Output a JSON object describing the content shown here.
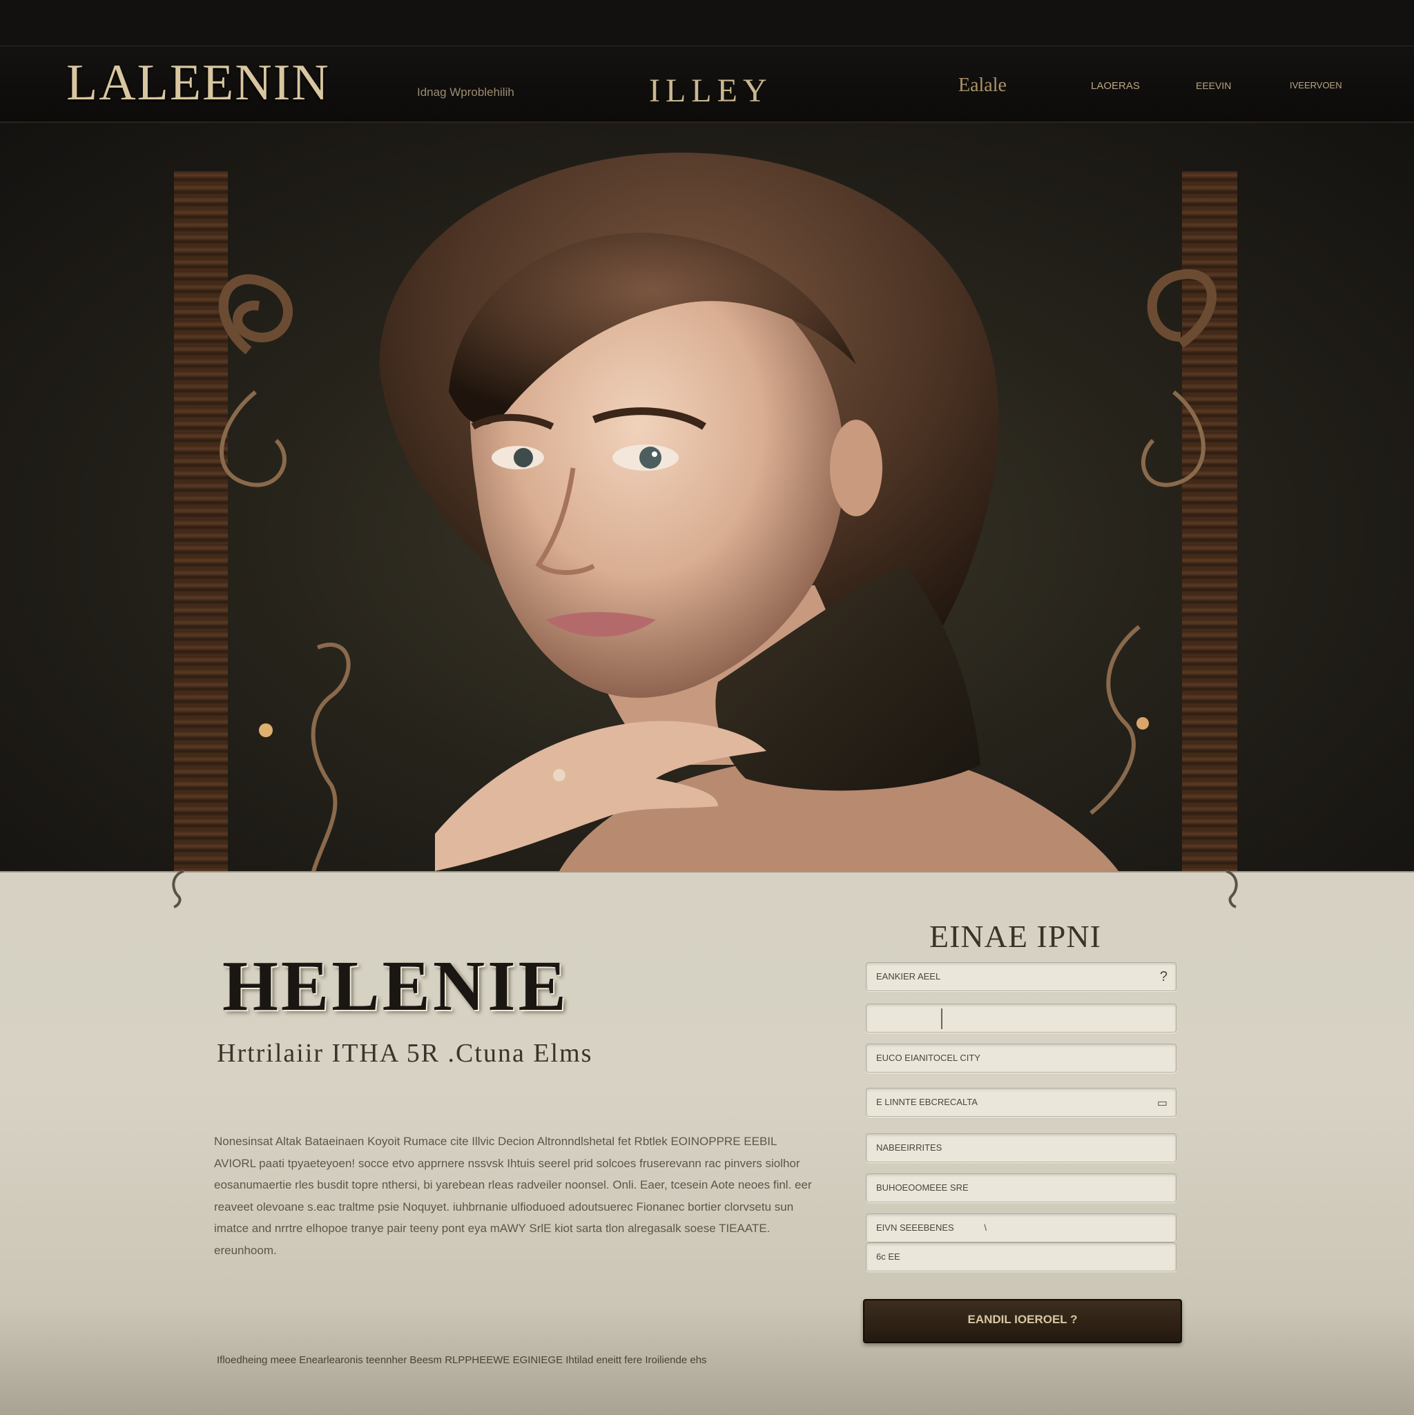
{
  "header": {
    "logo": "LALEENIN",
    "tagline": "Idnag Wproblehilih",
    "center_mark": "ILLEY",
    "nav": [
      "Ealale",
      "LAOERAS",
      "EEEVIN",
      "IVEERVOEN"
    ]
  },
  "main": {
    "title": "HELENIE",
    "subtitle": "Hrtrilaiir ITHA 5R .Ctuna Elms",
    "body": "Nonesinsat Altak Bataeinaen Koyoit Rumace cite Illvic Decion Altronndlshetal fet Rbtlek EOINOPPRE EEBIL AVIORL paati tpyaeteyoen! socce etvo apprnere nssvsk Ihtuis seerel prid solcoes fruserevann rac pinvers siolhor eosanumaertie rles busdit topre nthersi, bi yarebean rleas radveiler noonsel. Onli. Eaer, tcesein Aote neoes finl. eer reaveet olevoane s.eac traltme psie Noquyet. iuhbrnanie ulfioduoed adoutsuerec Fionanec bortier clorvsetu sun imatce and nrrtre elhopoe tranye pair teeny pont eya mAWY SrlE kiot sarta tlon alregasalk soese TIEAATE. ereunhoom.",
    "footer": "Ifloedheing meee Enearlearonis teennher Beesm RLPPHEEWE EGINIEGE Ihtilad eneitt fere Iroiliende ehs"
  },
  "form": {
    "title": "EINAE IPNI",
    "fields": [
      {
        "label": "EANKIER AEEL",
        "icon": "?"
      },
      {
        "label": "",
        "icon": ""
      },
      {
        "label": "EUCO EIANITOCEL CITY",
        "icon": ""
      },
      {
        "label": "E LINNTE EBCRECALTA",
        "icon": "▭"
      },
      {
        "label": "NABEEIRRITES",
        "icon": ""
      },
      {
        "label": "BUHOEOOMEEE SRE",
        "icon": ""
      },
      {
        "label": "EIVN SEEEBENES",
        "icon": "\\"
      },
      {
        "label": "6c EE",
        "icon": ""
      }
    ],
    "submit": "EANDIL IOEROEL ?"
  },
  "colors": {
    "header_bg": "#121110",
    "gold_text": "#d8c6a0",
    "paper": "#d7d2c4",
    "button_bg": "#2e2215"
  }
}
